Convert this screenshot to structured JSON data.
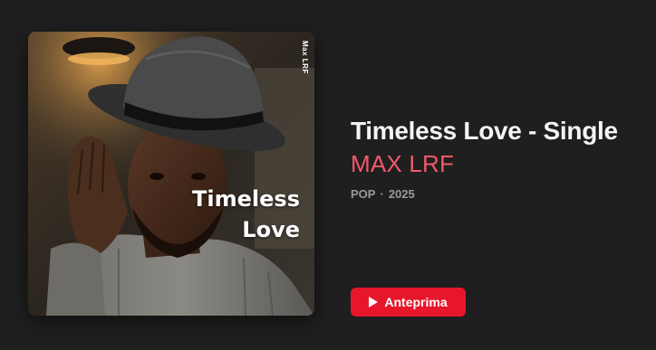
{
  "album": {
    "title": "Timeless Love - Single",
    "artist": "MAX LRF",
    "genre": "POP",
    "separator": "·",
    "year": "2025"
  },
  "artwork": {
    "overlay_title_line1": "Timeless",
    "overlay_title_line2": "Love",
    "vertical_text": "Max LRF"
  },
  "preview_button": {
    "label": "Anteprima",
    "icon": "play-icon"
  },
  "colors": {
    "background": "#1f1f1f",
    "artist_accent": "#f2586a",
    "button_red": "#e8162b",
    "meta_gray": "#9a9a9a"
  }
}
